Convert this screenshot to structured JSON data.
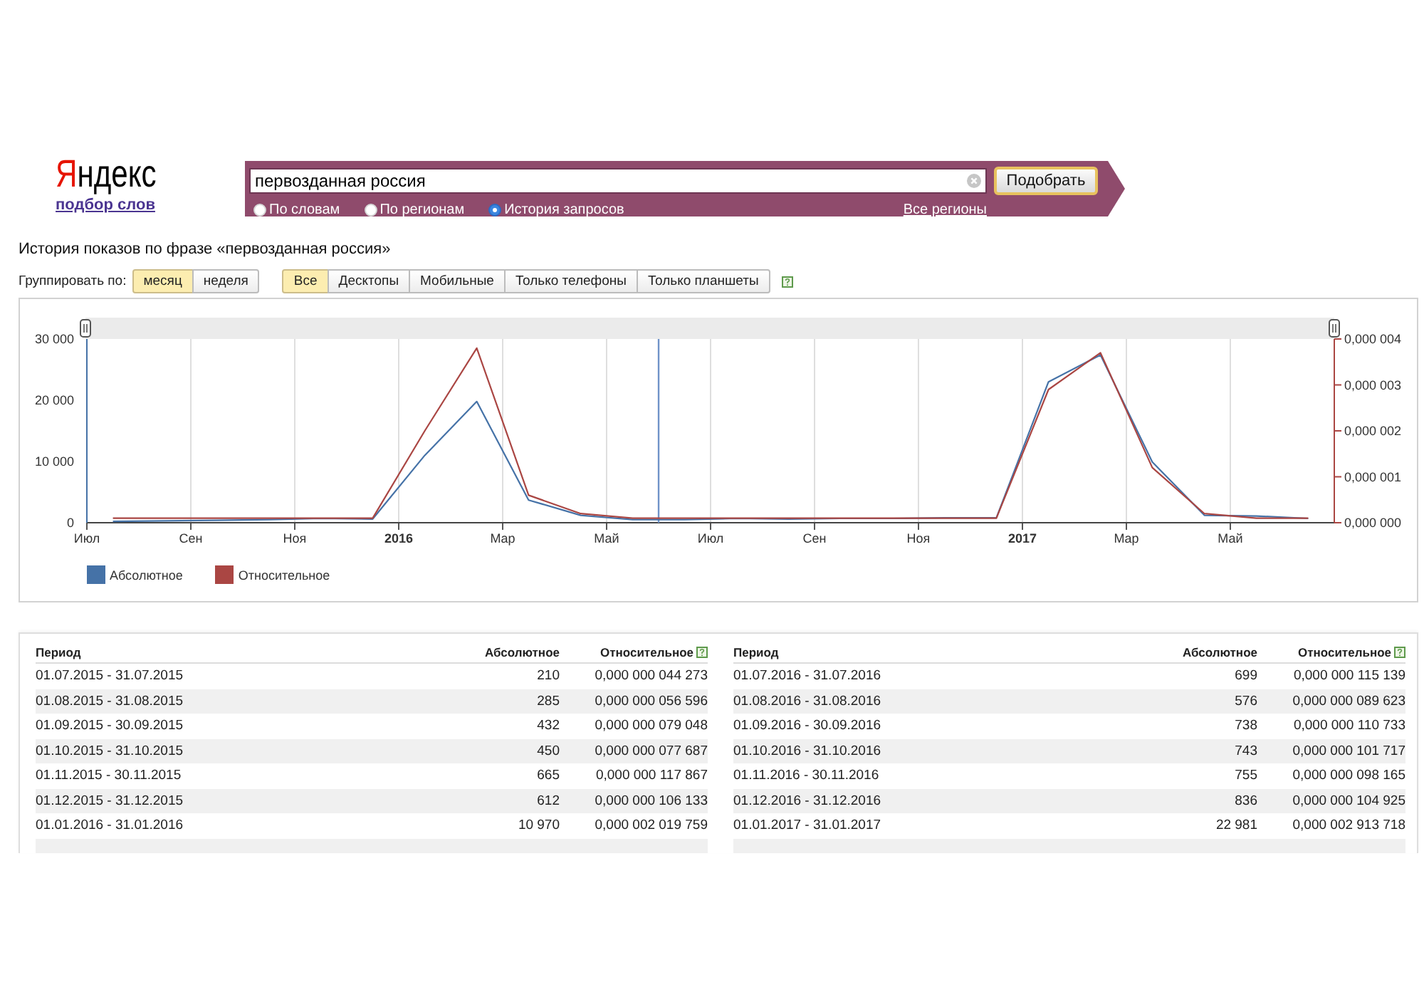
{
  "logo": {
    "text": "Яндекс",
    "service_link": "подбор слов"
  },
  "search": {
    "value": "первозданная россия",
    "button": "Подобрать",
    "modes": [
      {
        "label": "По словам",
        "selected": false
      },
      {
        "label": "По регионам",
        "selected": false
      },
      {
        "label": "История запросов",
        "selected": true
      }
    ],
    "regions_link": "Все регионы"
  },
  "heading": "История показов по фразе «первозданная россия»",
  "filters": {
    "group_label": "Группировать по:",
    "grouping": [
      {
        "label": "месяц",
        "selected": true
      },
      {
        "label": "неделя",
        "selected": false
      }
    ],
    "devices": [
      {
        "label": "Все",
        "selected": true
      },
      {
        "label": "Десктопы",
        "selected": false
      },
      {
        "label": "Мобильные",
        "selected": false
      },
      {
        "label": "Только телефоны",
        "selected": false
      },
      {
        "label": "Только планшеты",
        "selected": false
      }
    ]
  },
  "chart": {
    "chart_data": {
      "type": "line",
      "x": [
        2015.5417,
        2015.625,
        2015.7083,
        2015.7917,
        2015.875,
        2015.9583,
        2016.0417,
        2016.125,
        2016.2083,
        2016.2917,
        2016.375,
        2016.4583,
        2016.5417,
        2016.625,
        2016.7083,
        2016.7917,
        2016.875,
        2016.9583,
        2017.0417,
        2017.125,
        2017.2083,
        2017.2917,
        2017.375,
        2017.4583
      ],
      "series": [
        {
          "name": "Абсолютное",
          "color": "#4572a7",
          "values": [
            200,
            300,
            400,
            500,
            700,
            600,
            11000,
            19800,
            3700,
            1200,
            500,
            500,
            700,
            600,
            700,
            700,
            800,
            800,
            23000,
            27400,
            9900,
            1200,
            1100,
            700
          ]
        },
        {
          "name": "Относительное",
          "color": "#aa4643",
          "axis": "y2",
          "values": [
            1e-07,
            1e-07,
            1e-07,
            1e-07,
            1e-07,
            1e-07,
            2e-06,
            3.8e-06,
            6e-07,
            2e-07,
            1e-07,
            1e-07,
            1e-07,
            1e-07,
            1e-07,
            1e-07,
            1e-07,
            1e-07,
            2.9e-06,
            3.7e-06,
            1.2e-06,
            2e-07,
            1e-07,
            1e-07
          ]
        }
      ],
      "xlim": [
        2015.5,
        2017.5
      ],
      "ylim": [
        0,
        30000
      ],
      "y2lim": [
        0,
        4e-06
      ],
      "xticks": [
        {
          "value": 2015.5,
          "label": "Июл"
        },
        {
          "value": 2015.6667,
          "label": "Сен"
        },
        {
          "value": 2015.8333,
          "label": "Ноя"
        },
        {
          "value": 2016,
          "label": "2016"
        },
        {
          "value": 2016.1667,
          "label": "Мар"
        },
        {
          "value": 2016.3333,
          "label": "Май"
        },
        {
          "value": 2016.5,
          "label": "Июл"
        },
        {
          "value": 2016.6667,
          "label": "Сен"
        },
        {
          "value": 2016.8333,
          "label": "Ноя"
        },
        {
          "value": 2017,
          "label": "2017"
        },
        {
          "value": 2017.1667,
          "label": "Мар"
        },
        {
          "value": 2017.3333,
          "label": "Май"
        }
      ],
      "yticks": [
        {
          "value": 0,
          "label": "0"
        },
        {
          "value": 10000,
          "label": "10 000"
        },
        {
          "value": 20000,
          "label": "20 000"
        },
        {
          "value": 30000,
          "label": "30 000"
        }
      ],
      "y2ticks": [
        {
          "value": 0,
          "label": "0,000 000"
        },
        {
          "value": 1e-06,
          "label": "0,000 001"
        },
        {
          "value": 2e-06,
          "label": "0,000 002"
        },
        {
          "value": 3e-06,
          "label": "0,000 003"
        },
        {
          "value": 4e-06,
          "label": "0,000 004"
        }
      ],
      "ref_lines": [
        {
          "axis": "x",
          "value": 2016.4167
        }
      ],
      "legend": "bottom-left",
      "grid": "x"
    }
  },
  "tables": [
    {
      "columns": [
        {
          "label": "Период",
          "help": false
        },
        {
          "label": "Абсолютное",
          "help": false
        },
        {
          "label": "Относительное",
          "help": true
        }
      ],
      "rows": [
        [
          "01.07.2015 - 31.07.2015",
          "210",
          "0,000 000 044 273"
        ],
        [
          "01.08.2015 - 31.08.2015",
          "285",
          "0,000 000 056 596"
        ],
        [
          "01.09.2015 - 30.09.2015",
          "432",
          "0,000 000 079 048"
        ],
        [
          "01.10.2015 - 31.10.2015",
          "450",
          "0,000 000 077 687"
        ],
        [
          "01.11.2015 - 30.11.2015",
          "665",
          "0,000 000 117 867"
        ],
        [
          "01.12.2015 - 31.12.2015",
          "612",
          "0,000 000 106 133"
        ],
        [
          "01.01.2016 - 31.01.2016",
          "10 970",
          "0,000 002 019 759"
        ]
      ]
    },
    {
      "columns": [
        {
          "label": "Период",
          "help": false
        },
        {
          "label": "Абсолютное",
          "help": false
        },
        {
          "label": "Относительное",
          "help": true
        }
      ],
      "rows": [
        [
          "01.07.2016 - 31.07.2016",
          "699",
          "0,000 000 115 139"
        ],
        [
          "01.08.2016 - 31.08.2016",
          "576",
          "0,000 000 089 623"
        ],
        [
          "01.09.2016 - 30.09.2016",
          "738",
          "0,000 000 110 733"
        ],
        [
          "01.10.2016 - 31.10.2016",
          "743",
          "0,000 000 101 717"
        ],
        [
          "01.11.2016 - 30.11.2016",
          "755",
          "0,000 000 098 165"
        ],
        [
          "01.12.2016 - 31.12.2016",
          "836",
          "0,000 000 104 925"
        ],
        [
          "01.01.2017 - 31.01.2017",
          "22 981",
          "0,000 002 913 718"
        ]
      ]
    }
  ]
}
